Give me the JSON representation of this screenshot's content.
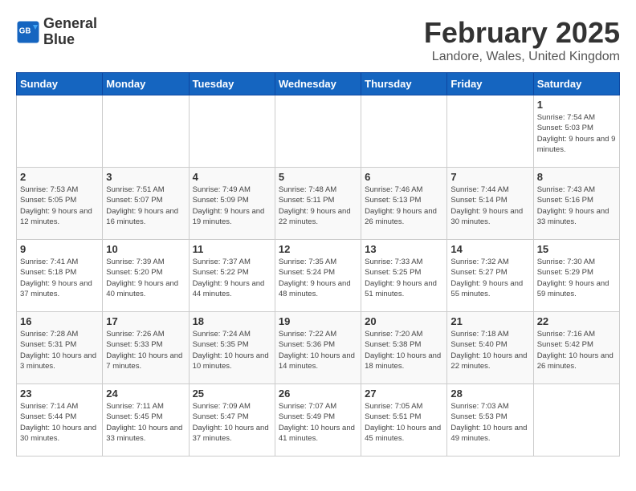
{
  "logo": {
    "line1": "General",
    "line2": "Blue"
  },
  "title": "February 2025",
  "subtitle": "Landore, Wales, United Kingdom",
  "weekdays": [
    "Sunday",
    "Monday",
    "Tuesday",
    "Wednesday",
    "Thursday",
    "Friday",
    "Saturday"
  ],
  "weeks": [
    [
      {
        "day": "",
        "info": ""
      },
      {
        "day": "",
        "info": ""
      },
      {
        "day": "",
        "info": ""
      },
      {
        "day": "",
        "info": ""
      },
      {
        "day": "",
        "info": ""
      },
      {
        "day": "",
        "info": ""
      },
      {
        "day": "1",
        "info": "Sunrise: 7:54 AM\nSunset: 5:03 PM\nDaylight: 9 hours and 9 minutes."
      }
    ],
    [
      {
        "day": "2",
        "info": "Sunrise: 7:53 AM\nSunset: 5:05 PM\nDaylight: 9 hours and 12 minutes."
      },
      {
        "day": "3",
        "info": "Sunrise: 7:51 AM\nSunset: 5:07 PM\nDaylight: 9 hours and 16 minutes."
      },
      {
        "day": "4",
        "info": "Sunrise: 7:49 AM\nSunset: 5:09 PM\nDaylight: 9 hours and 19 minutes."
      },
      {
        "day": "5",
        "info": "Sunrise: 7:48 AM\nSunset: 5:11 PM\nDaylight: 9 hours and 22 minutes."
      },
      {
        "day": "6",
        "info": "Sunrise: 7:46 AM\nSunset: 5:13 PM\nDaylight: 9 hours and 26 minutes."
      },
      {
        "day": "7",
        "info": "Sunrise: 7:44 AM\nSunset: 5:14 PM\nDaylight: 9 hours and 30 minutes."
      },
      {
        "day": "8",
        "info": "Sunrise: 7:43 AM\nSunset: 5:16 PM\nDaylight: 9 hours and 33 minutes."
      }
    ],
    [
      {
        "day": "9",
        "info": "Sunrise: 7:41 AM\nSunset: 5:18 PM\nDaylight: 9 hours and 37 minutes."
      },
      {
        "day": "10",
        "info": "Sunrise: 7:39 AM\nSunset: 5:20 PM\nDaylight: 9 hours and 40 minutes."
      },
      {
        "day": "11",
        "info": "Sunrise: 7:37 AM\nSunset: 5:22 PM\nDaylight: 9 hours and 44 minutes."
      },
      {
        "day": "12",
        "info": "Sunrise: 7:35 AM\nSunset: 5:24 PM\nDaylight: 9 hours and 48 minutes."
      },
      {
        "day": "13",
        "info": "Sunrise: 7:33 AM\nSunset: 5:25 PM\nDaylight: 9 hours and 51 minutes."
      },
      {
        "day": "14",
        "info": "Sunrise: 7:32 AM\nSunset: 5:27 PM\nDaylight: 9 hours and 55 minutes."
      },
      {
        "day": "15",
        "info": "Sunrise: 7:30 AM\nSunset: 5:29 PM\nDaylight: 9 hours and 59 minutes."
      }
    ],
    [
      {
        "day": "16",
        "info": "Sunrise: 7:28 AM\nSunset: 5:31 PM\nDaylight: 10 hours and 3 minutes."
      },
      {
        "day": "17",
        "info": "Sunrise: 7:26 AM\nSunset: 5:33 PM\nDaylight: 10 hours and 7 minutes."
      },
      {
        "day": "18",
        "info": "Sunrise: 7:24 AM\nSunset: 5:35 PM\nDaylight: 10 hours and 10 minutes."
      },
      {
        "day": "19",
        "info": "Sunrise: 7:22 AM\nSunset: 5:36 PM\nDaylight: 10 hours and 14 minutes."
      },
      {
        "day": "20",
        "info": "Sunrise: 7:20 AM\nSunset: 5:38 PM\nDaylight: 10 hours and 18 minutes."
      },
      {
        "day": "21",
        "info": "Sunrise: 7:18 AM\nSunset: 5:40 PM\nDaylight: 10 hours and 22 minutes."
      },
      {
        "day": "22",
        "info": "Sunrise: 7:16 AM\nSunset: 5:42 PM\nDaylight: 10 hours and 26 minutes."
      }
    ],
    [
      {
        "day": "23",
        "info": "Sunrise: 7:14 AM\nSunset: 5:44 PM\nDaylight: 10 hours and 30 minutes."
      },
      {
        "day": "24",
        "info": "Sunrise: 7:11 AM\nSunset: 5:45 PM\nDaylight: 10 hours and 33 minutes."
      },
      {
        "day": "25",
        "info": "Sunrise: 7:09 AM\nSunset: 5:47 PM\nDaylight: 10 hours and 37 minutes."
      },
      {
        "day": "26",
        "info": "Sunrise: 7:07 AM\nSunset: 5:49 PM\nDaylight: 10 hours and 41 minutes."
      },
      {
        "day": "27",
        "info": "Sunrise: 7:05 AM\nSunset: 5:51 PM\nDaylight: 10 hours and 45 minutes."
      },
      {
        "day": "28",
        "info": "Sunrise: 7:03 AM\nSunset: 5:53 PM\nDaylight: 10 hours and 49 minutes."
      },
      {
        "day": "",
        "info": ""
      }
    ]
  ]
}
